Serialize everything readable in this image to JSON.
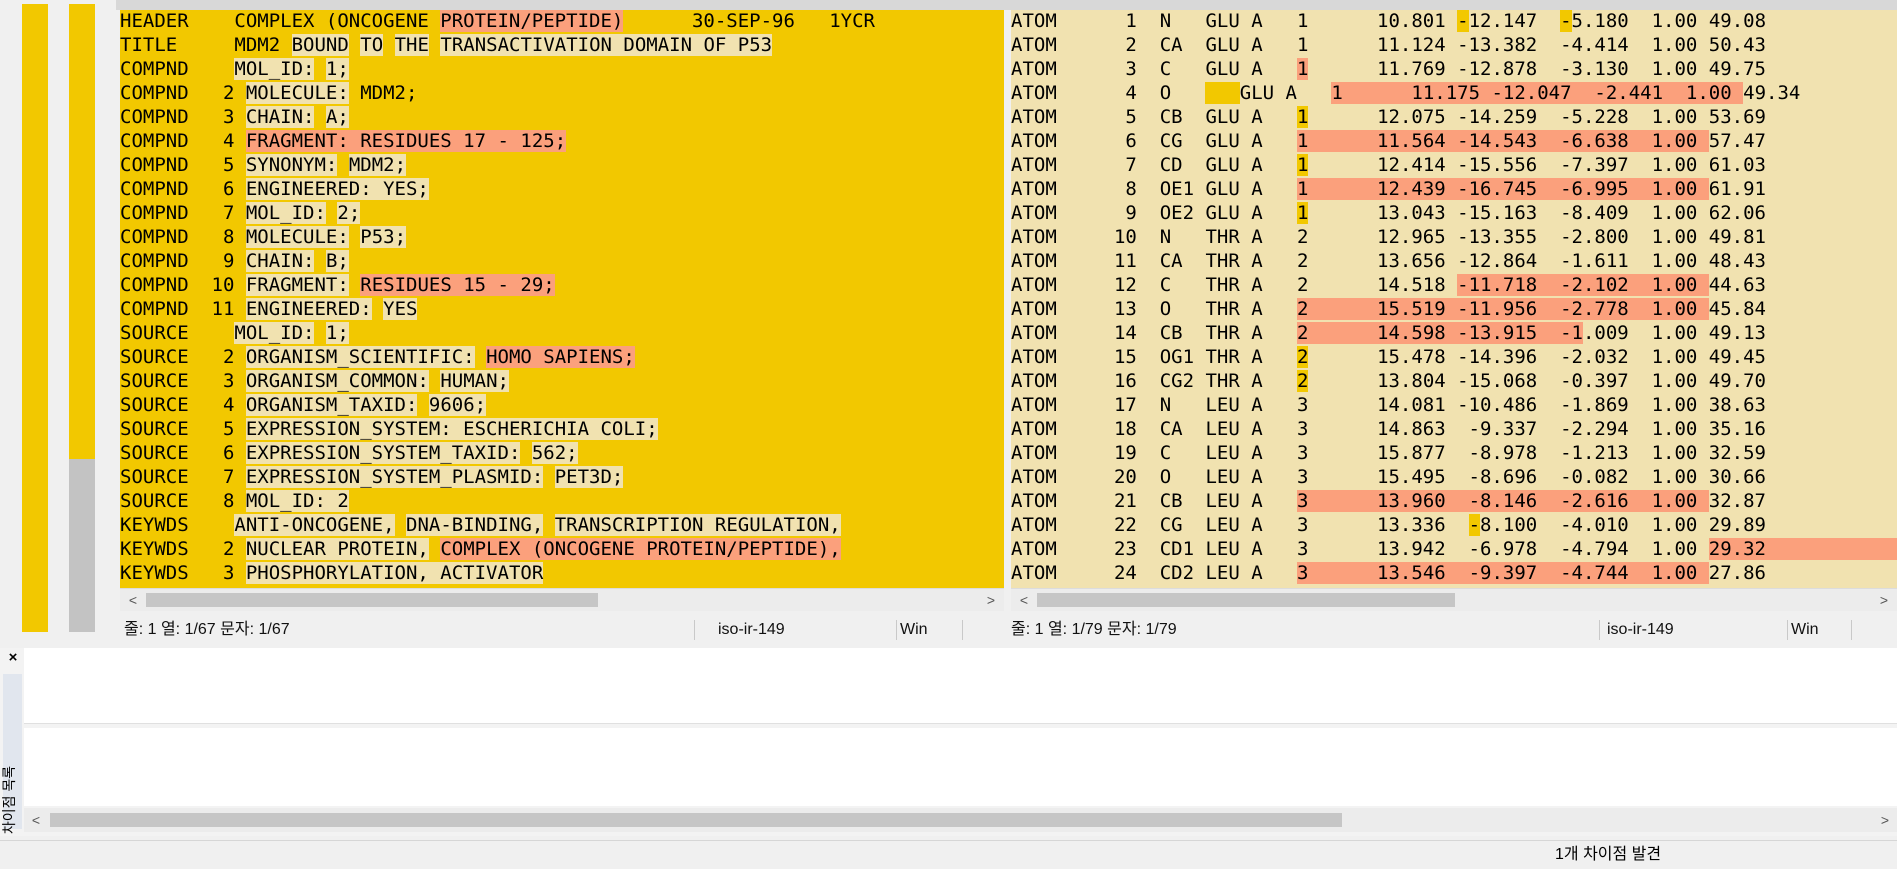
{
  "left": {
    "rows": [
      [
        [
          "HEADER    COMPLEX (ONCOGENE ",
          ""
        ],
        [
          "PROTEIN/PEPTIDE)",
          "hl"
        ],
        [
          "      30-SEP-96   1YCR",
          ""
        ]
      ],
      [
        [
          "TITLE     MDM2 ",
          ""
        ],
        [
          "BOUND",
          "pl"
        ],
        [
          " ",
          ""
        ],
        [
          "TO",
          "pl"
        ],
        [
          " ",
          ""
        ],
        [
          "THE",
          "pl"
        ],
        [
          " ",
          ""
        ],
        [
          "TRANSACTIVATION DOMAIN OF P53",
          "pl"
        ]
      ],
      [
        [
          "COMPND    ",
          ""
        ],
        [
          "MOL_ID:",
          "pl"
        ],
        [
          " ",
          ""
        ],
        [
          "1;",
          "pl"
        ]
      ],
      [
        [
          "COMPND   2 ",
          ""
        ],
        [
          "MOLECULE:",
          "pl"
        ],
        [
          " MDM2;",
          ""
        ]
      ],
      [
        [
          "COMPND   3 ",
          ""
        ],
        [
          "CHAIN:",
          "pl"
        ],
        [
          " ",
          ""
        ],
        [
          "A;",
          "pl"
        ]
      ],
      [
        [
          "COMPND   4 ",
          ""
        ],
        [
          "FRAGMENT: RESIDUES 17 - 125;",
          "hl"
        ]
      ],
      [
        [
          "COMPND   5 ",
          ""
        ],
        [
          "SYNONYM:",
          "pl"
        ],
        [
          " ",
          ""
        ],
        [
          "MDM2;",
          "pl"
        ]
      ],
      [
        [
          "COMPND   6 ",
          ""
        ],
        [
          "ENGINEERED: YES;",
          "pl"
        ]
      ],
      [
        [
          "COMPND   7 ",
          ""
        ],
        [
          "MOL_ID:",
          "pl"
        ],
        [
          " ",
          ""
        ],
        [
          "2;",
          "pl"
        ]
      ],
      [
        [
          "COMPND   8 ",
          ""
        ],
        [
          "MOLECULE:",
          "pl"
        ],
        [
          " ",
          ""
        ],
        [
          "P53;",
          "pl"
        ]
      ],
      [
        [
          "COMPND   9 ",
          ""
        ],
        [
          "CHAIN:",
          "pl"
        ],
        [
          " ",
          ""
        ],
        [
          "B;",
          "pl"
        ]
      ],
      [
        [
          "COMPND  10 ",
          ""
        ],
        [
          "FRAGMENT:",
          "pl"
        ],
        [
          " ",
          ""
        ],
        [
          "RESIDUES 15 - 29;",
          "hl"
        ]
      ],
      [
        [
          "COMPND  11 ",
          ""
        ],
        [
          "ENGINEERED:",
          "pl"
        ],
        [
          " ",
          ""
        ],
        [
          "YES",
          "pl"
        ]
      ],
      [
        [
          "SOURCE    ",
          ""
        ],
        [
          "MOL_ID:",
          "pl"
        ],
        [
          " ",
          ""
        ],
        [
          "1;",
          "pl"
        ]
      ],
      [
        [
          "SOURCE   2 ",
          ""
        ],
        [
          "ORGANISM_SCIENTIFIC:",
          "pl"
        ],
        [
          " ",
          ""
        ],
        [
          "HOMO SAPIENS;",
          "hl"
        ]
      ],
      [
        [
          "SOURCE   3 ",
          ""
        ],
        [
          "ORGANISM_COMMON:",
          "pl"
        ],
        [
          " ",
          ""
        ],
        [
          "HUMAN;",
          "pl"
        ]
      ],
      [
        [
          "SOURCE   4 ",
          ""
        ],
        [
          "ORGANISM_TAXID:",
          "pl"
        ],
        [
          " ",
          ""
        ],
        [
          "9606;",
          "pl"
        ]
      ],
      [
        [
          "SOURCE   5 ",
          ""
        ],
        [
          "EXPRESSION_SYSTEM: ESCHERICHIA COLI;",
          "pl"
        ]
      ],
      [
        [
          "SOURCE   6 ",
          ""
        ],
        [
          "EXPRESSION_SYSTEM_TAXID:",
          "pl"
        ],
        [
          " ",
          ""
        ],
        [
          "562;",
          "pl"
        ]
      ],
      [
        [
          "SOURCE   7 ",
          ""
        ],
        [
          "EXPRESSION_SYSTEM_PLASMID:",
          "pl"
        ],
        [
          " ",
          ""
        ],
        [
          "PET3D;",
          "pl"
        ]
      ],
      [
        [
          "SOURCE   8 ",
          ""
        ],
        [
          "MOL_ID: 2",
          "pl"
        ]
      ],
      [
        [
          "KEYWDS    ",
          ""
        ],
        [
          "ANTI-ONCOGENE,",
          "pl"
        ],
        [
          " ",
          ""
        ],
        [
          "DNA-BINDING,",
          "pl"
        ],
        [
          " ",
          ""
        ],
        [
          "TRANSCRIPTION REGULATION,",
          "pl"
        ]
      ],
      [
        [
          "KEYWDS   2 ",
          ""
        ],
        [
          "NUCLEAR PROTEIN,",
          "pl"
        ],
        [
          " ",
          ""
        ],
        [
          "COMPLEX (ONCOGENE PROTEIN/PEPTIDE),",
          "hl"
        ]
      ],
      [
        [
          "KEYWDS   3 ",
          ""
        ],
        [
          "PHOSPHORYLATION, ACTIVATOR",
          "pl"
        ]
      ]
    ],
    "status": {
      "pos": "줄: 1  열: 1/67  문자: 1/67",
      "enc": "iso-ir-149",
      "eol": "Win"
    }
  },
  "right": {
    "rows": [
      [
        [
          "ATOM      1  N   GLU A   1      10.801 ",
          ""
        ],
        [
          "-",
          "yl"
        ],
        [
          "12.147  ",
          ""
        ],
        [
          "-",
          "yl"
        ],
        [
          "5.180  1.00 49.08",
          ""
        ]
      ],
      [
        [
          "ATOM      2  CA  GLU A   1      11.124 -13.382  -4.414  1.00 50.43",
          ""
        ]
      ],
      [
        [
          "ATOM      3  C   GLU A   ",
          ""
        ],
        [
          "1",
          "hl"
        ],
        [
          "      11.769 -12.878  -3.130  1.00 49.75",
          ""
        ]
      ],
      [
        [
          "ATOM      4  O   ",
          ""
        ],
        [
          "   ",
          "yl"
        ],
        [
          "GLU A   ",
          ""
        ],
        [
          "1      11.175 -12.047  -2.441  1.00 ",
          "hl"
        ],
        [
          "49.34",
          ""
        ]
      ],
      [
        [
          "ATOM      5  CB  GLU A   ",
          ""
        ],
        [
          "1",
          "yl"
        ],
        [
          "      12.075 -14.259  -5.228  1.00 53.69",
          ""
        ]
      ],
      [
        [
          "ATOM      6  CG  GLU A   ",
          ""
        ],
        [
          "1      11.564 -14.543  -6.638  1.00 ",
          "hl"
        ],
        [
          "57.47",
          ""
        ]
      ],
      [
        [
          "ATOM      7  CD  GLU A   ",
          ""
        ],
        [
          "1",
          "yl"
        ],
        [
          "      12.414 -15.556  -7.397  1.00 61.03",
          ""
        ]
      ],
      [
        [
          "ATOM      8  OE1 GLU A   ",
          ""
        ],
        [
          "1      12.439 -16.745  -6.995  1.00 ",
          "hl"
        ],
        [
          "61.91",
          ""
        ]
      ],
      [
        [
          "ATOM      9  OE2 GLU A   ",
          ""
        ],
        [
          "1",
          "yl"
        ],
        [
          "      13.043 -15.163  -8.409  1.00 62.06",
          ""
        ]
      ],
      [
        [
          "ATOM     10  N   THR A   2      12.965 -13.355  -2.800  1.00 49.81",
          ""
        ]
      ],
      [
        [
          "ATOM     11  CA  THR A   2      13.656 -12.864  -1.611  1.00 48.43",
          ""
        ]
      ],
      [
        [
          "ATOM     12  C   THR A   2      14.518 ",
          ""
        ],
        [
          "-11.718  -2.102  1.00 ",
          "hl"
        ],
        [
          "44.63",
          ""
        ]
      ],
      [
        [
          "ATOM     13  O   THR A   ",
          ""
        ],
        [
          "2      15.519 -11.956  -2.778  1.00 ",
          "hl"
        ],
        [
          "45.84",
          ""
        ]
      ],
      [
        [
          "ATOM     14  CB  THR A   ",
          ""
        ],
        [
          "2      14.598 -13.915  -1",
          "hl"
        ],
        [
          ".009  1.00 49.13",
          ""
        ]
      ],
      [
        [
          "ATOM     15  OG1 THR A   ",
          ""
        ],
        [
          "2",
          "yl"
        ],
        [
          "      15.478 -14.396  -2.032  1.00 49.45",
          ""
        ]
      ],
      [
        [
          "ATOM     16  CG2 THR A   ",
          ""
        ],
        [
          "2",
          "yl"
        ],
        [
          "      13.804 -15.068  -0.397  1.00 49.70",
          ""
        ]
      ],
      [
        [
          "ATOM     17  N   LEU A   3      14.081 -10.486  -1.869  1.00 38.63",
          ""
        ]
      ],
      [
        [
          "ATOM     18  CA  LEU A   3      14.863  -9.337  -2.294  1.00 35.16",
          ""
        ]
      ],
      [
        [
          "ATOM     19  C   LEU A   3      15.877  -8.978  -1.213  1.00 32.59",
          ""
        ]
      ],
      [
        [
          "ATOM     20  O   LEU A   3      15.495  -8.696  -0.082  1.00 30.66",
          ""
        ]
      ],
      [
        [
          "ATOM     21  CB  LEU A   ",
          ""
        ],
        [
          "3      13.960  -8.146  -2.616  1.00 ",
          "hl"
        ],
        [
          "32.87",
          ""
        ]
      ],
      [
        [
          "ATOM     22  CG  LEU A   3      13.336  ",
          ""
        ],
        [
          "-",
          "yl"
        ],
        [
          "8.100  -4.010  1.00 29.89",
          ""
        ]
      ],
      [
        [
          "ATOM     23  CD1 LEU A   3      13.942  -6.978  -4.794  1.00 ",
          ""
        ],
        [
          "29.32                ",
          "hl"
        ]
      ],
      [
        [
          "ATOM     24  CD2 LEU A   ",
          ""
        ],
        [
          "3      13.546  -9.397  -4.744  1.00 ",
          "hl"
        ],
        [
          "27.86",
          ""
        ]
      ]
    ],
    "status": {
      "pos": "줄: 1  열: 1/79  문자: 1/79",
      "enc": "iso-ir-149",
      "eol": "Win"
    }
  },
  "diff_panel": {
    "close_glyph": "×",
    "tab_label": "차이점 목록"
  },
  "bottom_status": "1개 차이점 발견",
  "scroll": {
    "left_arrow": "<",
    "right_arrow": ">"
  },
  "colors": {
    "diff_yellow": "#f2c800",
    "changed_salmon": "#fba07c",
    "pale_equal": "#f1e2b0"
  }
}
